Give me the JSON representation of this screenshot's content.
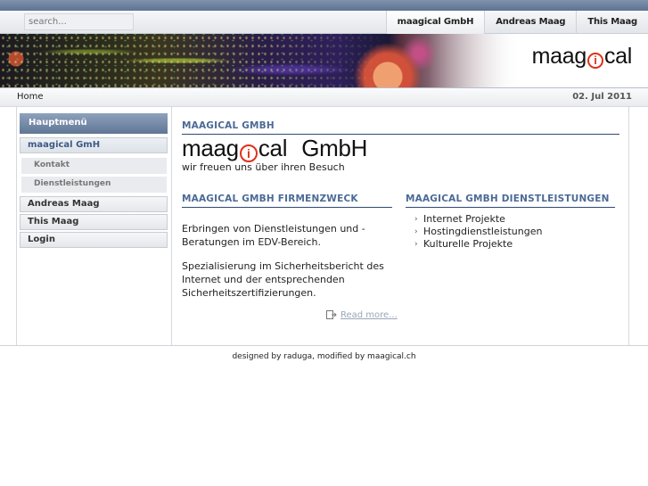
{
  "search": {
    "placeholder": "search..."
  },
  "topnav": {
    "items": [
      {
        "label": "maagical GmbH"
      },
      {
        "label": "Andreas Maag"
      },
      {
        "label": "This Maag"
      }
    ]
  },
  "logo": {
    "part1": "maag",
    "icon_letter": "i",
    "part2": "cal"
  },
  "breadcrumb": {
    "home": "Home",
    "date": "02. Jul 2011"
  },
  "sidebar": {
    "header": "Hauptmenü",
    "items": [
      {
        "label": "maagical GmH"
      },
      {
        "label": "Kontakt"
      },
      {
        "label": "Dienstleistungen"
      },
      {
        "label": "Andreas Maag"
      },
      {
        "label": "This Maag"
      },
      {
        "label": "Login"
      }
    ]
  },
  "main": {
    "section_title": "MAAGICAL GMBH",
    "brand": {
      "part1": "maag",
      "icon_letter": "i",
      "part2": "cal",
      "suffix": "GmbH"
    },
    "welcome": "wir freuen uns über ihren Besuch",
    "purpose": {
      "title": "MAAGICAL GMBH FIRMENZWECK",
      "paragraph1": "Erbringen von Dienstleistungen und - Beratungen im EDV-Bereich.",
      "paragraph2": "Spezialisierung im Sicherheitsbericht des Internet und der entsprechenden Sicherheitszertifizierungen.",
      "read_more": "Read more..."
    },
    "services": {
      "title": "MAAGICAL GMBH DIENSTLEISTUNGEN",
      "items": [
        "Internet Projekte",
        "Hostingdienstleistungen",
        "Kulturelle Projekte"
      ]
    }
  },
  "footer": {
    "text": "designed by raduga, modified by maagical.ch"
  },
  "colors": {
    "accent": "#4b6a96",
    "logo_icon": "#e0301a",
    "menu_head": "#6d829f"
  }
}
